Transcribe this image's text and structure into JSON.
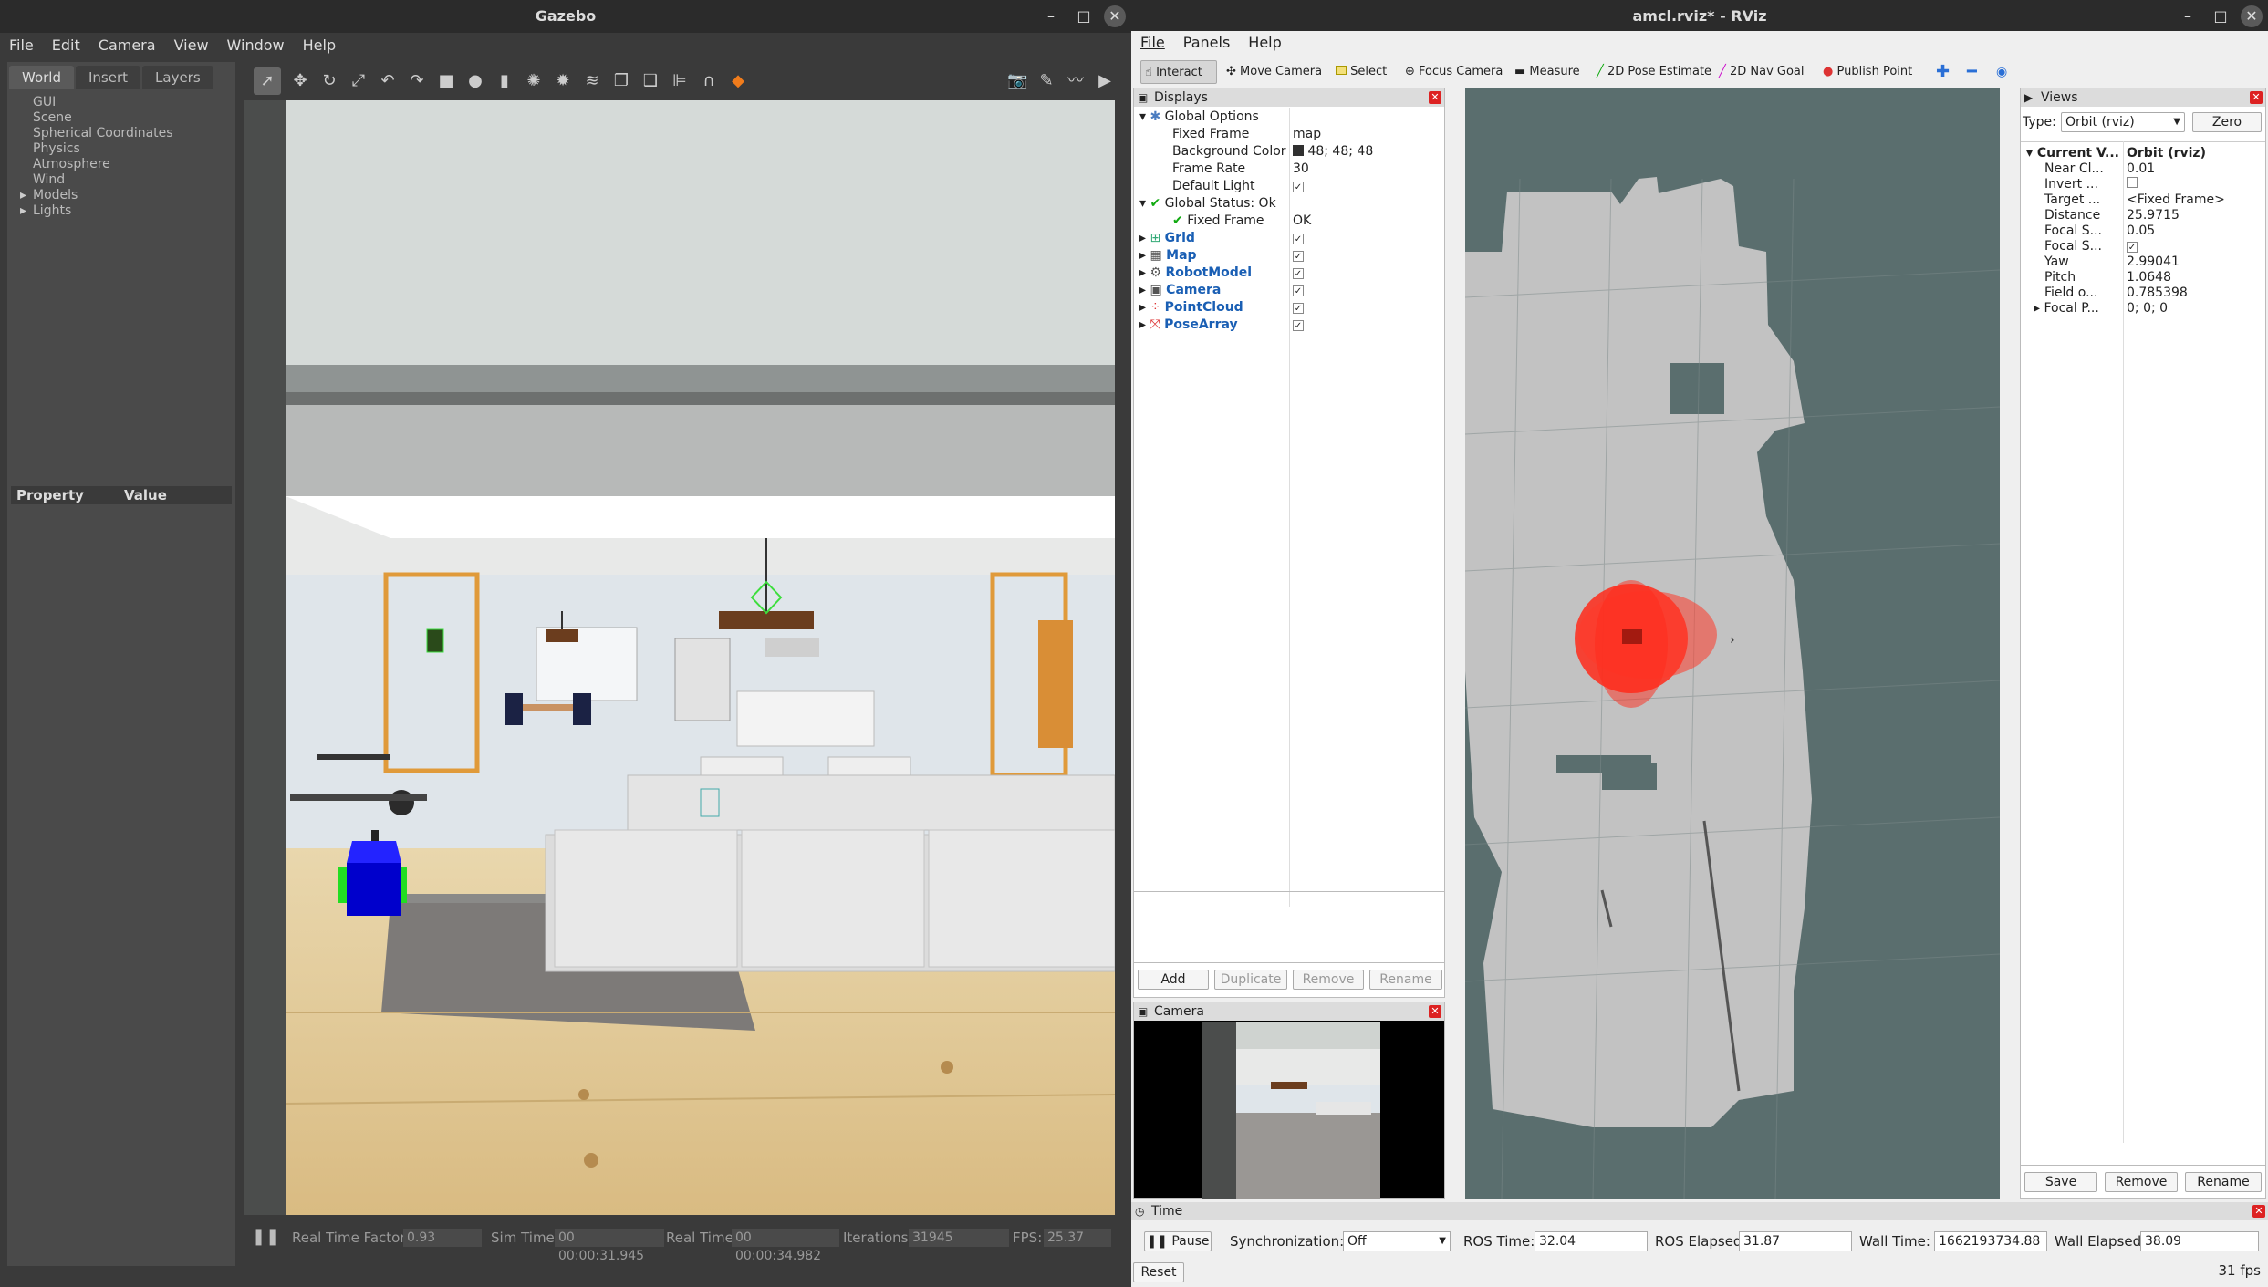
{
  "gazebo": {
    "title": "Gazebo",
    "menu": [
      "File",
      "Edit",
      "Camera",
      "View",
      "Window",
      "Help"
    ],
    "tabs": [
      "World",
      "Insert",
      "Layers"
    ],
    "world_tree": [
      "GUI",
      "Scene",
      "Spherical Coordinates",
      "Physics",
      "Atmosphere",
      "Wind",
      "Models",
      "Lights"
    ],
    "prop_header": {
      "property": "Property",
      "value": "Value"
    },
    "status": {
      "rtf_label": "Real Time Factor:",
      "rtf": "0.93",
      "sim_label": "Sim Time:",
      "sim": "00 00:00:31.945",
      "real_label": "Real Time:",
      "real": "00 00:00:34.982",
      "iter_label": "Iterations:",
      "iter": "31945",
      "fps_label": "FPS:",
      "fps": "25.37"
    }
  },
  "rviz": {
    "title": "amcl.rviz* - RViz",
    "menu": [
      "File",
      "Panels",
      "Help"
    ],
    "tools": [
      "Interact",
      "Move Camera",
      "Select",
      "Focus Camera",
      "Measure",
      "2D Pose Estimate",
      "2D Nav Goal",
      "Publish Point"
    ],
    "displays": {
      "title": "Displays",
      "global_options": "Global Options",
      "fixed_frame_label": "Fixed Frame",
      "fixed_frame": "map",
      "bg_label": "Background Color",
      "bg": "48; 48; 48",
      "fr_label": "Frame Rate",
      "fr": "30",
      "dl_label": "Default Light",
      "status_label": "Global Status: Ok",
      "ff_label": "Fixed Frame",
      "ff_val": "OK",
      "items": [
        "Grid",
        "Map",
        "RobotModel",
        "Camera",
        "PointCloud",
        "PoseArray"
      ],
      "buttons": [
        "Add",
        "Duplicate",
        "Remove",
        "Rename"
      ]
    },
    "camera_panel": "Camera",
    "views": {
      "title": "Views",
      "type_label": "Type:",
      "type": "Orbit (rviz)",
      "zero": "Zero",
      "current_label": "Current V...",
      "current": "Orbit (rviz)",
      "props": [
        [
          "Near Cl...",
          "0.01"
        ],
        [
          "Invert ...",
          ""
        ],
        [
          "Target ...",
          "<Fixed Frame>"
        ],
        [
          "Distance",
          "25.9715"
        ],
        [
          "Focal S...",
          "0.05"
        ],
        [
          "Focal S...",
          "✓"
        ],
        [
          "Yaw",
          "2.99041"
        ],
        [
          "Pitch",
          "1.0648"
        ],
        [
          "Field o...",
          "0.785398"
        ],
        [
          "Focal P...",
          "0; 0; 0"
        ]
      ],
      "buttons": [
        "Save",
        "Remove",
        "Rename"
      ]
    },
    "time": {
      "title": "Time",
      "pause": "Pause",
      "sync_label": "Synchronization:",
      "sync": "Off",
      "ros_time_label": "ROS Time:",
      "ros_time": "32.04",
      "ros_el_label": "ROS Elapsed:",
      "ros_el": "31.87",
      "wall_label": "Wall Time:",
      "wall": "1662193734.88",
      "wall_el_label": "Wall Elapsed:",
      "wall_el": "38.09",
      "reset": "Reset",
      "fps": "31 fps"
    }
  },
  "colors": {
    "particles": "#ff2a1a",
    "map_free": "#c0c0c0",
    "map_unknown": "#5a6e6e",
    "robot_body": "#1010e0",
    "wheel": "#22dd22"
  }
}
